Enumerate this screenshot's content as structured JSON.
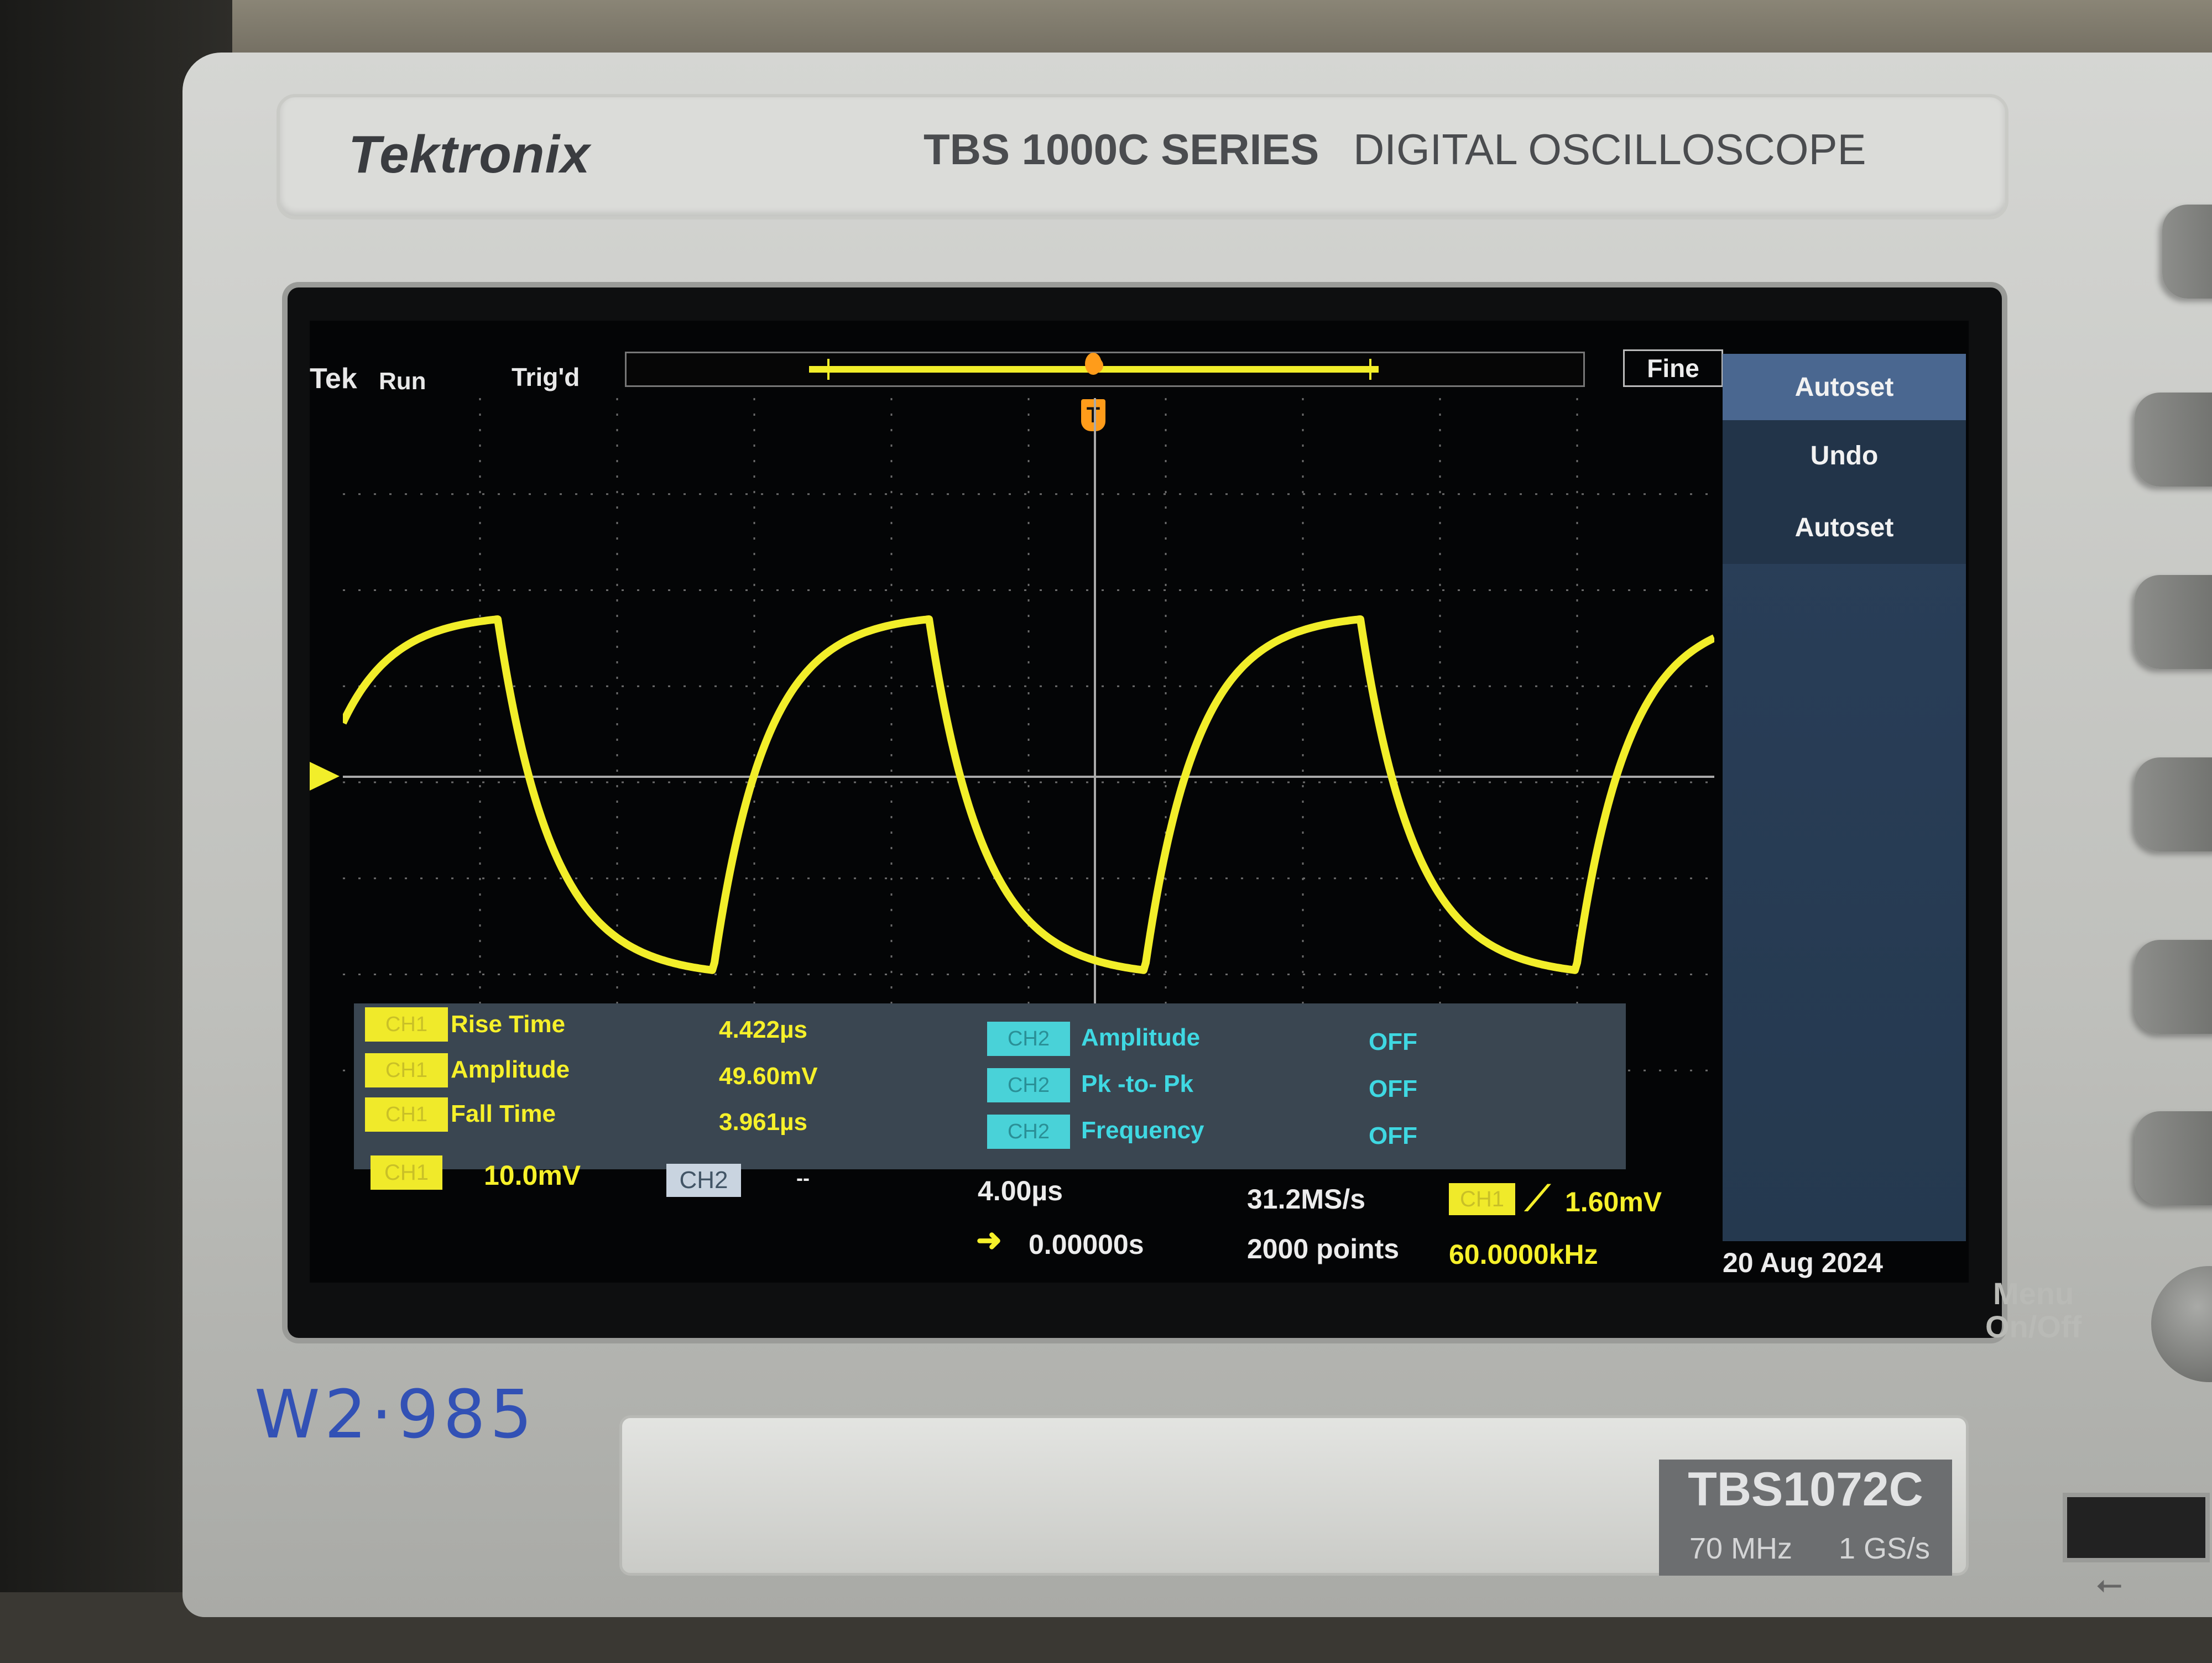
{
  "device": {
    "brand": "Tektronix",
    "series_bold": "TBS 1000C SERIES",
    "series_light": "DIGITAL OSCILLOSCOPE",
    "model": "TBS1072C",
    "bandwidth": "70 MHz",
    "sample_rate_spec": "1 GS/s",
    "menu_button_label_line1": "Menu",
    "menu_button_label_line2": "On/Off",
    "handwritten_label": "W2·985"
  },
  "status": {
    "logo": "Tek",
    "run_state": "Run",
    "trigger_state": "Trig'd",
    "zoom_mode": "Fine",
    "trigger_marker": "T",
    "ch1_marker": "1"
  },
  "side_menu": {
    "items": [
      "Autoset",
      "Undo",
      "Autoset"
    ]
  },
  "measurements": {
    "ch1": [
      {
        "channel": "CH1",
        "name": "Rise Time",
        "value": "4.422µs"
      },
      {
        "channel": "CH1",
        "name": "Amplitude",
        "value": "49.60mV"
      },
      {
        "channel": "CH1",
        "name": "Fall Time",
        "value": "3.961µs"
      }
    ],
    "ch2": [
      {
        "channel": "CH2",
        "name": "Amplitude",
        "value": "OFF"
      },
      {
        "channel": "CH2",
        "name": "Pk -to- Pk",
        "value": "OFF"
      },
      {
        "channel": "CH2",
        "name": "Frequency",
        "value": "OFF"
      }
    ]
  },
  "bottom": {
    "ch1_label": "CH1",
    "ch1_scale": "10.0mV",
    "ch2_label": "CH2",
    "ch2_scale": "--",
    "time_per_div": "4.00µs",
    "horizontal_position": "0.00000s",
    "sample_rate": "31.2MS/s",
    "record_length": "2000 points",
    "trigger_source": "CH1",
    "trigger_level": "1.60mV",
    "trigger_frequency": "60.0000kHz",
    "date": "20 Aug 2024"
  },
  "colors": {
    "ch1": "#f2ee2a",
    "ch2": "#3fd8e2",
    "trigger": "#ff9c1a",
    "menu_bg": "#25394f"
  }
}
